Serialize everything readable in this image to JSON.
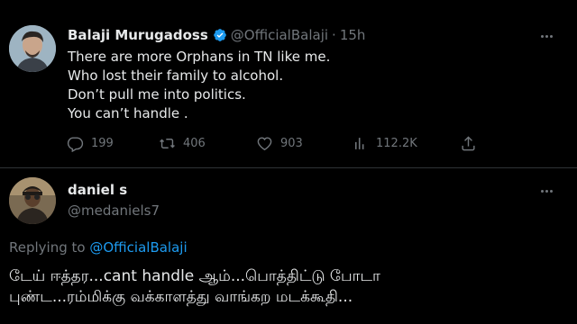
{
  "tweet": {
    "author_name": "Balaji Murugadoss",
    "author_handle": "@OfficialBalaji",
    "separator": "·",
    "time": "15h",
    "lines": [
      "There are more Orphans in TN like me.",
      "Who lost their family to alcohol.",
      "Don’t pull me into politics.",
      "You can’t handle ."
    ],
    "stats": {
      "replies": "199",
      "retweets": "406",
      "likes": "903",
      "views": "112.2K"
    }
  },
  "reply": {
    "author_name": "daniel s",
    "author_handle": "@medaniels7",
    "replying_prefix": "Replying to",
    "replying_mention": "@OfficialBalaji",
    "lines": [
      "டேய் ஈத்தர...cant handle ஆம்...பொத்திட்டு போடா",
      "புண்ட...ரம்மிக்கு வக்காளத்து வாங்கற மடக்கூதி..."
    ]
  },
  "colors": {
    "background": "#000000",
    "text": "#e7e9ea",
    "muted": "#71767b",
    "accent": "#1d9bf0",
    "divider": "#2f3336"
  },
  "icons": [
    "verified-badge-icon",
    "more-options-icon",
    "reply-icon",
    "retweet-icon",
    "like-icon",
    "views-icon",
    "share-icon"
  ]
}
